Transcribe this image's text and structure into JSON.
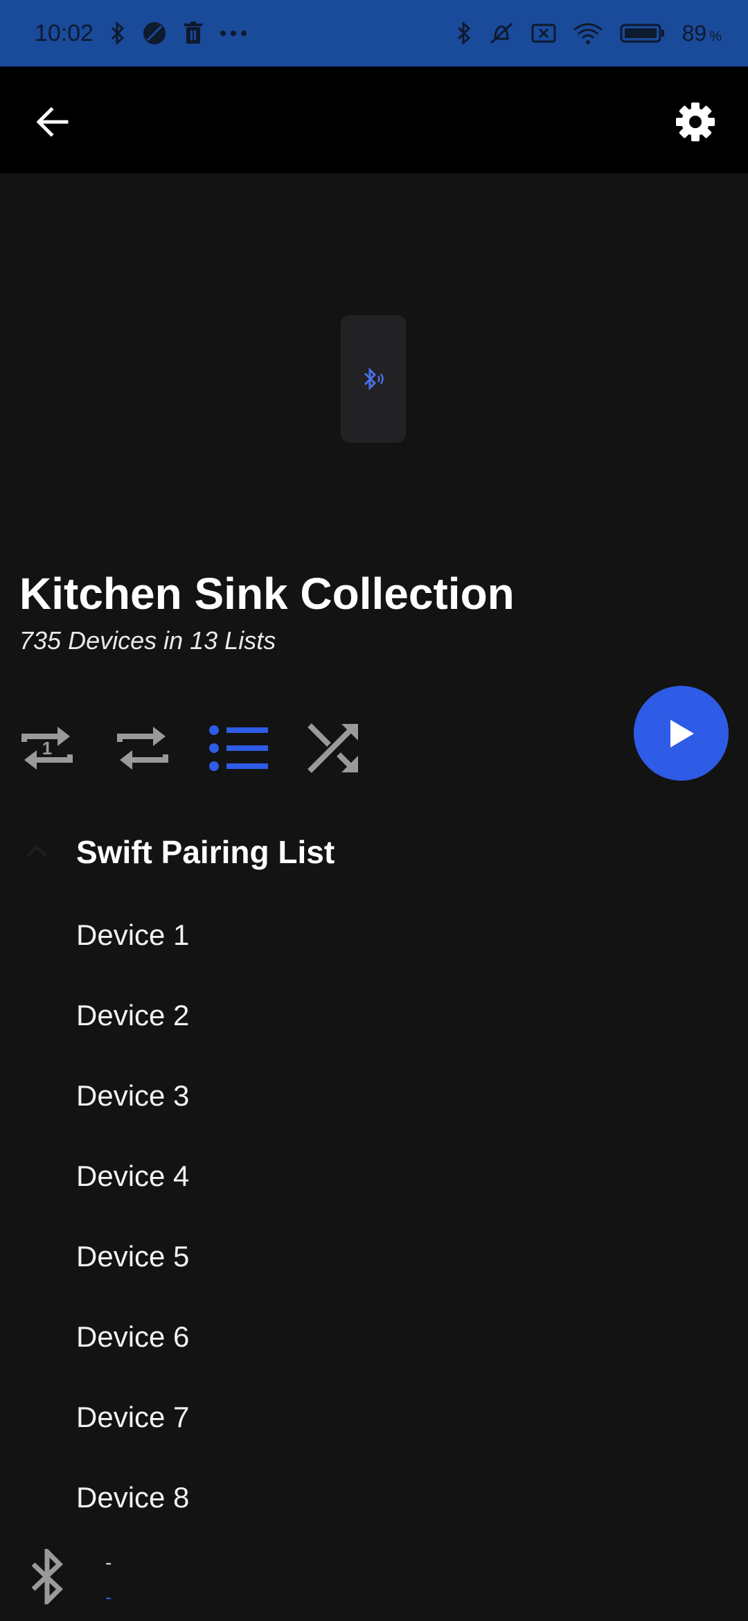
{
  "status_bar": {
    "time": "10:02",
    "battery_percent": "89",
    "battery_unit": "%",
    "background_color": "#1A4A9A"
  },
  "app_bar": {
    "back_icon": "arrow-left-icon",
    "settings_icon": "gear-icon"
  },
  "collection": {
    "title": "Kitchen Sink Collection",
    "subtitle": "735 Devices in 13 Lists"
  },
  "controls": {
    "items": [
      {
        "name": "repeat-one-icon",
        "active": false
      },
      {
        "name": "repeat-icon",
        "active": false
      },
      {
        "name": "list-icon",
        "active": true
      },
      {
        "name": "shuffle-icon",
        "active": false
      }
    ],
    "play_icon": "play-icon",
    "accent_color": "#2F5CE6"
  },
  "list": {
    "title": "Swift Pairing List",
    "devices": [
      "Device 1",
      "Device 2",
      "Device 3",
      "Device 4",
      "Device 5",
      "Device 6",
      "Device 7",
      "Device 8"
    ]
  },
  "bottom_bar": {
    "icon": "bluetooth-icon",
    "line1": "-",
    "line2": "-"
  }
}
